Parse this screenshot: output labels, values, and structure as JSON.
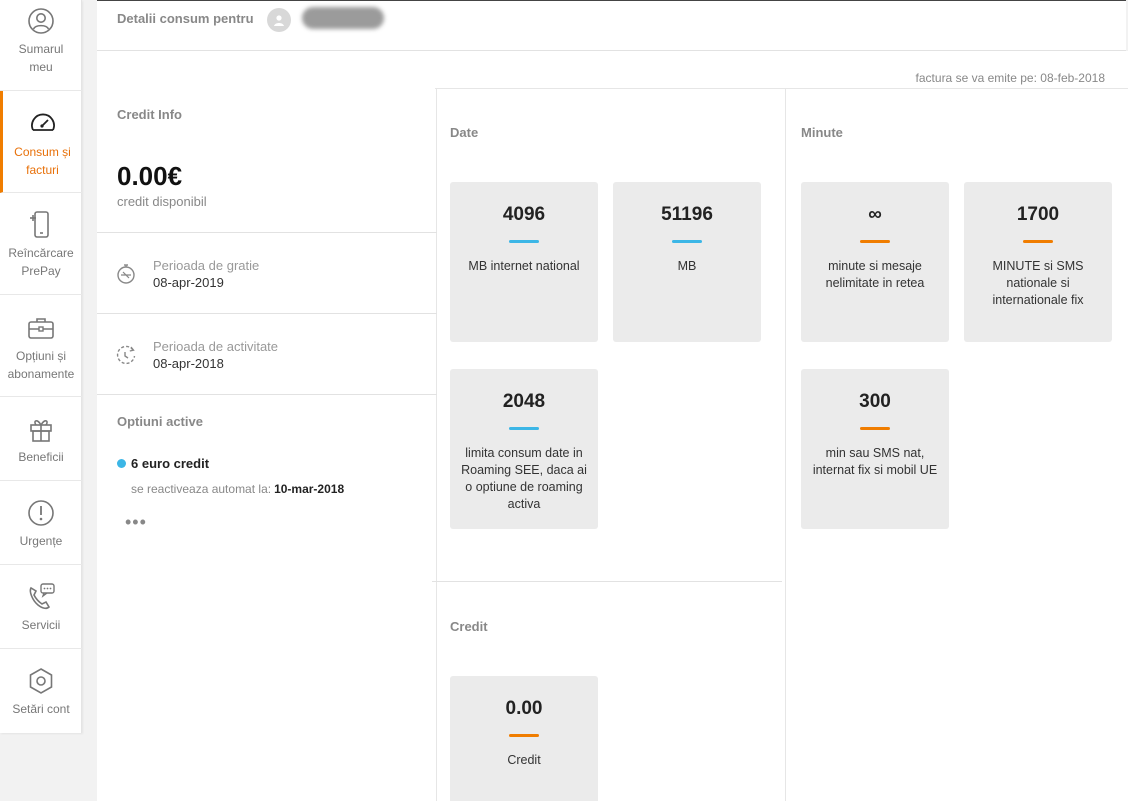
{
  "sidebar": {
    "items": [
      {
        "label": "Sumarul meu",
        "icon": "user-circle-icon"
      },
      {
        "label": "Consum și facturi",
        "icon": "speedometer-icon"
      },
      {
        "label": "Reîncărcare PrePay",
        "icon": "phone-recharge-icon"
      },
      {
        "label": "Opțiuni și abonamente",
        "icon": "briefcase-icon"
      },
      {
        "label": "Beneficii",
        "icon": "gift-icon"
      },
      {
        "label": "Urgențe",
        "icon": "alert-icon"
      },
      {
        "label": "Servicii",
        "icon": "phone-chat-icon"
      },
      {
        "label": "Setări cont",
        "icon": "settings-hexagon-icon"
      }
    ],
    "active_index": 1,
    "active_color": "#f07d00"
  },
  "header": {
    "title": "Detalii consum pentru"
  },
  "invoice_note": "factura se va emite pe: 08-feb-2018",
  "credit_info": {
    "title": "Credit Info",
    "amount": "0.00€",
    "subtitle": "credit disponibil"
  },
  "periods": [
    {
      "label": "Perioada de gratie",
      "value": "08-apr-2019",
      "icon": "timer-icon"
    },
    {
      "label": "Perioada de activitate",
      "value": "08-apr-2018",
      "icon": "clock-rotate-icon"
    }
  ],
  "active_options": {
    "title": "Optiuni active",
    "item": "6 euro credit",
    "reactivate_label": "se reactiveaza automat la:",
    "reactivate_date": "10-mar-2018",
    "more": "•••"
  },
  "date_section": {
    "title": "Date",
    "tiles": [
      {
        "value": "4096",
        "desc": "MB internet national",
        "color": "#3cb6e6"
      },
      {
        "value": "51196",
        "desc": "MB",
        "color": "#3cb6e6"
      },
      {
        "value": "2048",
        "desc": "limita consum date in Roaming SEE, daca ai o optiune de roaming activa",
        "color": "#3cb6e6"
      }
    ]
  },
  "minute_section": {
    "title": "Minute",
    "tiles": [
      {
        "value": "∞",
        "desc": "minute si mesaje nelimitate in retea",
        "color": "#f07d00"
      },
      {
        "value": "1700",
        "desc": "MINUTE si SMS nationale si internationale fix",
        "color": "#f07d00"
      },
      {
        "value": "300",
        "desc": "min sau SMS nat, internat fix si mobil UE",
        "color": "#f07d00"
      }
    ]
  },
  "credit_section": {
    "title": "Credit",
    "tiles": [
      {
        "value": "0.00",
        "desc": "Credit",
        "color": "#f07d00"
      }
    ]
  }
}
